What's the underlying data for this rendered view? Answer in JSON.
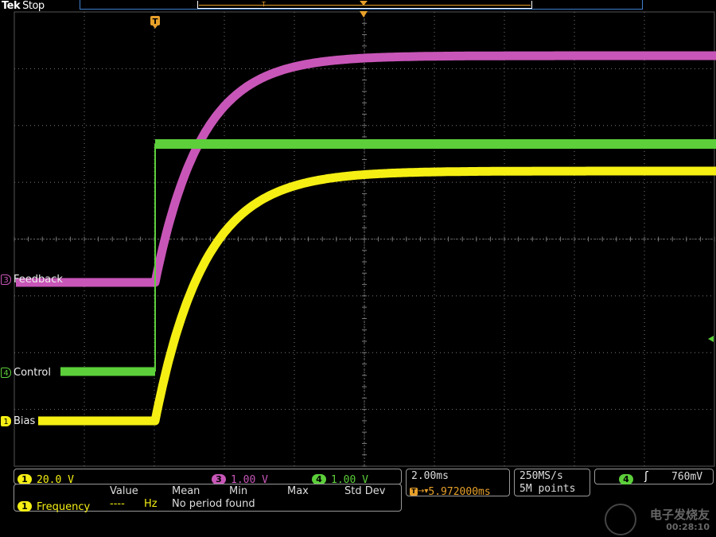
{
  "header": {
    "brand": "Tek",
    "status": "Stop",
    "trigger_marker": "T"
  },
  "colors": {
    "ch1": "#f5ef14",
    "ch3": "#c856b8",
    "ch4": "#5ccf3a",
    "orange": "#e7a02a",
    "grid": "#7a7a7a"
  },
  "channels": [
    {
      "num": "3",
      "label": "Feedback",
      "color": "#c856b8"
    },
    {
      "num": "4",
      "label": "Control",
      "color": "#5ccf3a"
    },
    {
      "num": "1",
      "label": "Bias",
      "color": "#f5ef14"
    }
  ],
  "vertical": {
    "ch1_scale": "20.0 V",
    "ch3_scale": "1.00 V",
    "ch4_scale": "1.00 V",
    "ch1_num": "1",
    "ch3_num": "3",
    "ch4_num": "4"
  },
  "horizontal": {
    "time_per_div": "2.00ms",
    "delay": "5.972000ms"
  },
  "acquisition": {
    "sample_rate": "250MS/s",
    "record_length": "5M points"
  },
  "trigger": {
    "source": "4",
    "slope_icon": "rising-edge-icon",
    "level": "760mV"
  },
  "measurements": {
    "headers": [
      "Value",
      "Mean",
      "Min",
      "Max",
      "Std Dev"
    ],
    "rows": [
      {
        "channel": "1",
        "name": "Frequency",
        "value": "----",
        "unit": "Hz",
        "message": "No period found"
      }
    ]
  },
  "watermark": {
    "text": "电子发烧友",
    "subtext": "00:28:10"
  }
}
